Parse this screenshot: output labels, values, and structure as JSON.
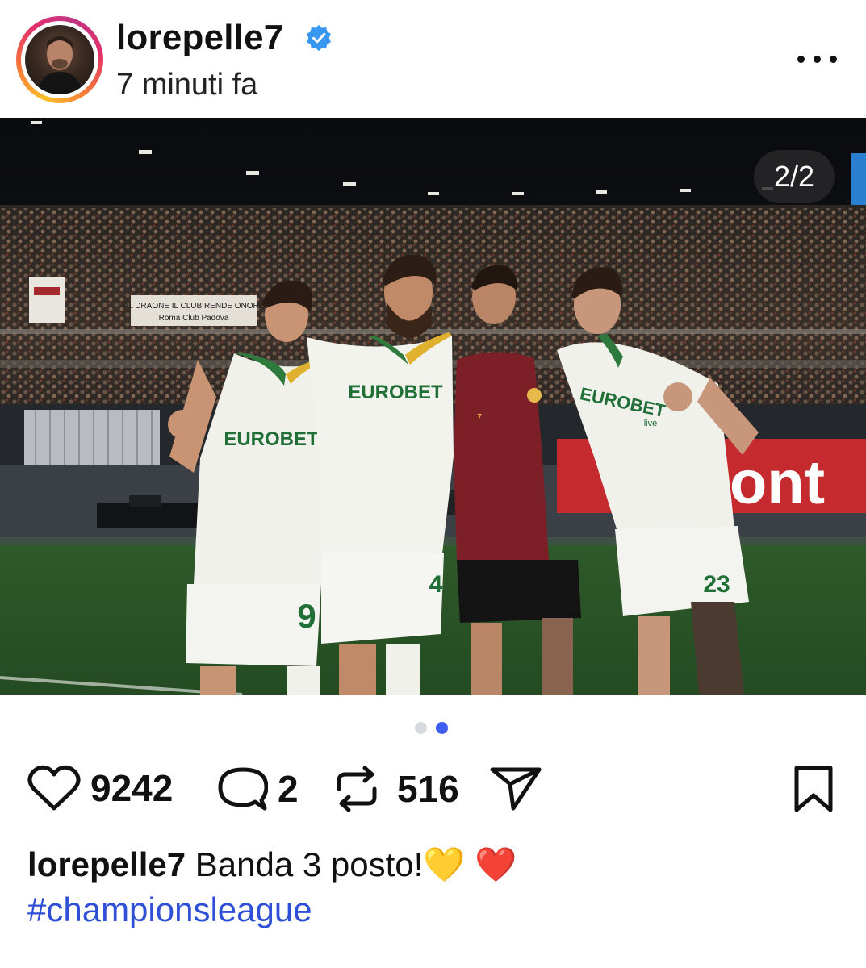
{
  "post": {
    "username": "lorepelle7",
    "verified": true,
    "timestamp": "7 minuti fa",
    "media_counter": "2/2",
    "carousel": {
      "total": 2,
      "current": 2
    }
  },
  "photo_text": {
    "sponsor_left": "EUROBET",
    "sponsor_middle": "EUROBET",
    "sponsor_right": "EUROBET",
    "sponsor_suffix": "live",
    "number_left": "9",
    "number_middle": "4",
    "number_right": "23",
    "maroon_number": "7",
    "banner": "AL DRAONE IL CLUB RENDE ONORE",
    "banner_sub": "Roma Club Padova",
    "board": "ont"
  },
  "actions": {
    "likes": "9242",
    "comments": "2",
    "reposts": "516"
  },
  "caption": {
    "username": "lorepelle7",
    "text": "Banda 3 posto!💛 ❤️",
    "hashtag": "#championsleague"
  },
  "colors": {
    "link": "#2f4fd6",
    "verified": "#3897f0",
    "dot_active": "#3f5cf0",
    "dot_inactive": "#d7dbe0"
  },
  "icons": {
    "verified": "verified-badge-icon",
    "more": "more-options-icon",
    "like": "heart-icon",
    "comment": "comment-bubble-icon",
    "repost": "repost-icon",
    "share": "send-icon",
    "save": "bookmark-icon"
  }
}
